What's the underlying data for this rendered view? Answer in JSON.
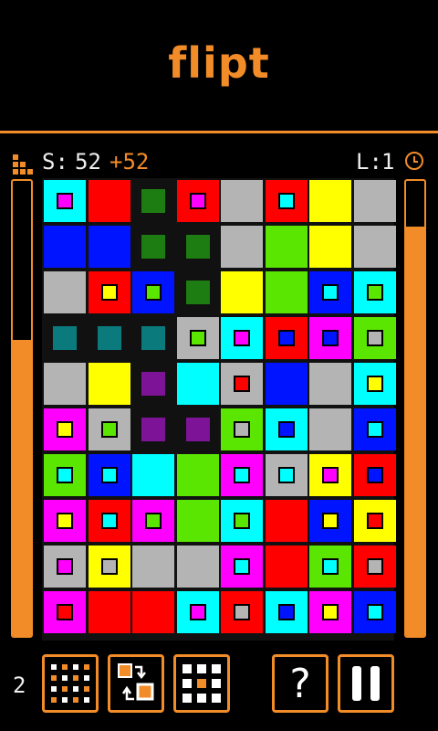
{
  "app": {
    "title": "flipt"
  },
  "status": {
    "score_label": "S:",
    "score": "52",
    "bonus": "+52",
    "level_label": "L:",
    "level": "1"
  },
  "meters": {
    "left_fill_fraction": 0.65,
    "right_fill_fraction": 0.9
  },
  "toolbar": {
    "count": "2"
  },
  "icons": {
    "stats": "bar-stats-icon",
    "clock": "clock-icon",
    "grid_all": "dots-grid-icon",
    "swap": "swap-icon",
    "grid_center": "center-dot-grid-icon",
    "help": "question-icon",
    "pause": "pause-icon"
  },
  "palette": {
    "C": "#00ffff",
    "R": "#ff0000",
    "Y": "#ffff00",
    "S": "#b4b4b4",
    "B": "#0014ff",
    "G": "#5ae600",
    "M": "#ff00ff",
    "D": "#1e7d12",
    "T": "#0a7a7d",
    "P": "#7d1497",
    "N": "#000000",
    "accent": "#f28c28"
  },
  "grid": [
    [
      {
        "c": "C",
        "i": "M"
      },
      {
        "c": "R"
      },
      {
        "c": "D",
        "s": 1
      },
      {
        "c": "R",
        "i": "M"
      },
      {
        "c": "S"
      },
      {
        "c": "R",
        "i": "C"
      },
      {
        "c": "Y"
      },
      {
        "c": "S"
      }
    ],
    [
      {
        "c": "B"
      },
      {
        "c": "B"
      },
      {
        "c": "D",
        "s": 1
      },
      {
        "c": "D",
        "s": 1
      },
      {
        "c": "S"
      },
      {
        "c": "G"
      },
      {
        "c": "Y"
      },
      {
        "c": "S"
      }
    ],
    [
      {
        "c": "S"
      },
      {
        "c": "R",
        "i": "Y"
      },
      {
        "c": "B",
        "i": "G"
      },
      {
        "c": "D",
        "s": 1
      },
      {
        "c": "Y"
      },
      {
        "c": "G"
      },
      {
        "c": "B",
        "i": "C"
      },
      {
        "c": "C",
        "i": "G"
      }
    ],
    [
      {
        "c": "T",
        "s": 1
      },
      {
        "c": "T",
        "s": 1
      },
      {
        "c": "T",
        "s": 1
      },
      {
        "c": "S",
        "i": "G"
      },
      {
        "c": "C",
        "i": "M"
      },
      {
        "c": "R",
        "i": "B"
      },
      {
        "c": "M",
        "i": "B"
      },
      {
        "c": "G",
        "i": "S"
      }
    ],
    [
      {
        "c": "S"
      },
      {
        "c": "Y"
      },
      {
        "c": "P",
        "s": 1
      },
      {
        "c": "C"
      },
      {
        "c": "S",
        "i": "R"
      },
      {
        "c": "B"
      },
      {
        "c": "S"
      },
      {
        "c": "C",
        "i": "Y"
      }
    ],
    [
      {
        "c": "M",
        "i": "Y"
      },
      {
        "c": "S",
        "i": "G"
      },
      {
        "c": "P",
        "s": 1
      },
      {
        "c": "P",
        "s": 1
      },
      {
        "c": "G",
        "i": "S"
      },
      {
        "c": "C",
        "i": "B"
      },
      {
        "c": "S"
      },
      {
        "c": "B",
        "i": "C"
      }
    ],
    [
      {
        "c": "G",
        "i": "C"
      },
      {
        "c": "B",
        "i": "C"
      },
      {
        "c": "C"
      },
      {
        "c": "G"
      },
      {
        "c": "M",
        "i": "C"
      },
      {
        "c": "S",
        "i": "C"
      },
      {
        "c": "Y",
        "i": "M"
      },
      {
        "c": "R",
        "i": "B"
      }
    ],
    [
      {
        "c": "M",
        "i": "Y"
      },
      {
        "c": "R",
        "i": "C"
      },
      {
        "c": "M",
        "i": "G"
      },
      {
        "c": "G"
      },
      {
        "c": "C",
        "i": "G"
      },
      {
        "c": "R"
      },
      {
        "c": "B",
        "i": "Y"
      },
      {
        "c": "Y",
        "i": "R"
      }
    ],
    [
      {
        "c": "S",
        "i": "M"
      },
      {
        "c": "Y",
        "i": "S"
      },
      {
        "c": "S"
      },
      {
        "c": "S"
      },
      {
        "c": "M",
        "i": "C"
      },
      {
        "c": "R"
      },
      {
        "c": "G",
        "i": "C"
      },
      {
        "c": "R",
        "i": "S"
      }
    ],
    [
      {
        "c": "M",
        "i": "R"
      },
      {
        "c": "R"
      },
      {
        "c": "R"
      },
      {
        "c": "C",
        "i": "M"
      },
      {
        "c": "R",
        "i": "S"
      },
      {
        "c": "C",
        "i": "B"
      },
      {
        "c": "M",
        "i": "Y"
      },
      {
        "c": "B",
        "i": "C"
      }
    ]
  ]
}
